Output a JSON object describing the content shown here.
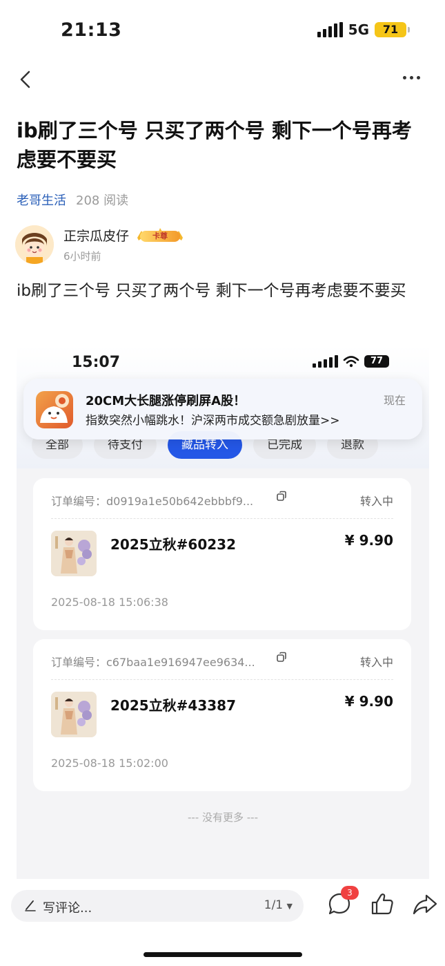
{
  "status_bar": {
    "time": "21:13",
    "network": "5G",
    "battery": "71"
  },
  "post": {
    "title": "ib刷了三个号 只买了两个号 剩下一个号再考虑要不要买",
    "category": "老哥生活",
    "reads": "208 阅读",
    "author": {
      "name": "正宗瓜皮仔",
      "badge": "卡尊",
      "time": "6小时前"
    },
    "body": "ib刷了三个号 只买了两个号 剩下一个号再考虑要不要买"
  },
  "screenshot": {
    "time": "15:07",
    "battery": "77",
    "notification": {
      "title": "20CM大长腿涨停刷屏A股！",
      "subtitle": "指数突然小幅跳水！沪深两市成交额急剧放量>>",
      "time": "现在"
    },
    "tabs": [
      "全部",
      "待支付",
      "藏品转入",
      "已完成",
      "退款"
    ],
    "active_tab": 2,
    "orders": [
      {
        "id_label": "订单编号：d0919a1e50b642ebbbf9...",
        "status": "转入中",
        "name": "2025立秋#60232",
        "price": "¥ 9.90",
        "date": "2025-08-18 15:06:38"
      },
      {
        "id_label": "订单编号：c67baa1e916947ee9634...",
        "status": "转入中",
        "name": "2025立秋#43387",
        "price": "¥ 9.90",
        "date": "2025-08-18 15:02:00"
      }
    ],
    "no_more": "--- 没有更多 ---"
  },
  "bottom_bar": {
    "comment_placeholder": "写评论...",
    "page_indicator": "1/1",
    "comment_count": "3"
  },
  "colors": {
    "accent": "#2457e6",
    "link": "#2a5fb8",
    "badge_red": "#f04141",
    "battery_yellow": "#f5c518"
  }
}
